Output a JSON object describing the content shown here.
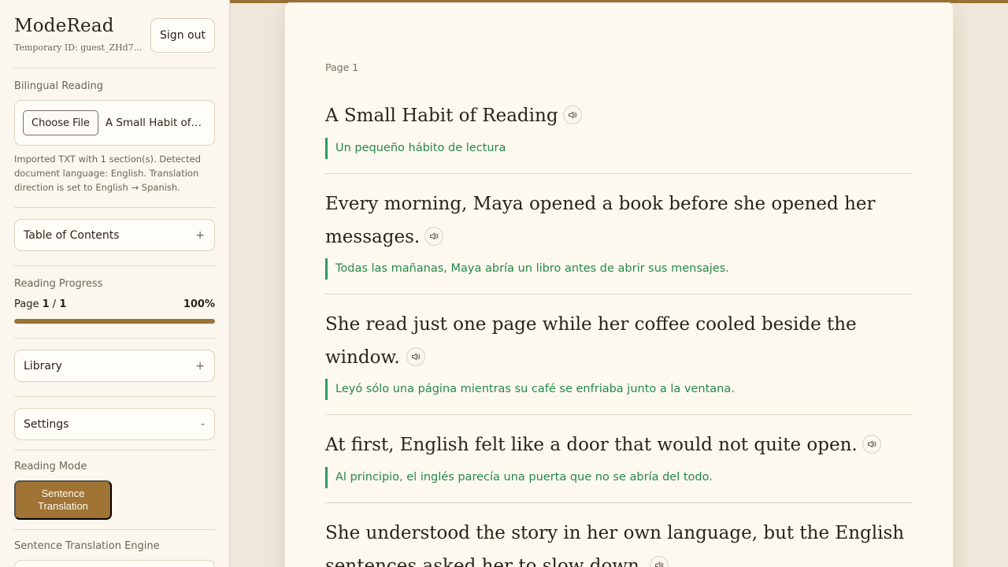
{
  "sidebar": {
    "brand": "ModeRead",
    "temp_id": "Temporary ID: guest_ZHd7...",
    "sign_out_label": "Sign out",
    "bilingual_label": "Bilingual Reading",
    "choose_file_label": "Choose File",
    "file_name": "A Small Habit of ...",
    "import_note": "Imported TXT with 1 section(s). Detected document language: English. Translation direction is set to English → Spanish.",
    "toc_label": "Table of Contents",
    "toc_sign": "+",
    "progress_label": "Reading Progress",
    "page_word": "Page",
    "page_current": "1",
    "page_slash": " / ",
    "page_total": "1",
    "progress_percent": "100%",
    "progress_fraction": 1.0,
    "library_label": "Library",
    "library_sign": "+",
    "settings_label": "Settings",
    "settings_sign": "-",
    "reading_mode_label": "Reading Mode",
    "mode_button_line1": "Sentence",
    "mode_button_line2": "Translation",
    "engine_label": "Sentence Translation Engine"
  },
  "reader": {
    "page_label": "Page 1",
    "speak_icon": "speaker-icon",
    "sentences": [
      {
        "text": "A Small Habit of Reading",
        "translation": "Un pequeño hábito de lectura"
      },
      {
        "text": "Every morning, Maya opened a book before she opened her messages.",
        "translation": "Todas las mañanas, Maya abría un libro antes de abrir sus mensajes."
      },
      {
        "text": "She read just one page while her coffee cooled beside the window.",
        "translation": "Leyó sólo una página mientras su café se enfriaba junto a la ventana."
      },
      {
        "text": "At first, English felt like a door that would not quite open.",
        "translation": "Al principio, el inglés parecía una puerta que no se abría del todo."
      },
      {
        "text": "She understood the story in her own language, but the English sentences asked her to slow down."
      }
    ]
  },
  "colors": {
    "accent": "#9a7136",
    "translation": "#26874a",
    "translation_bar": "#2f9a5a",
    "paper": "#fdf9ef"
  }
}
